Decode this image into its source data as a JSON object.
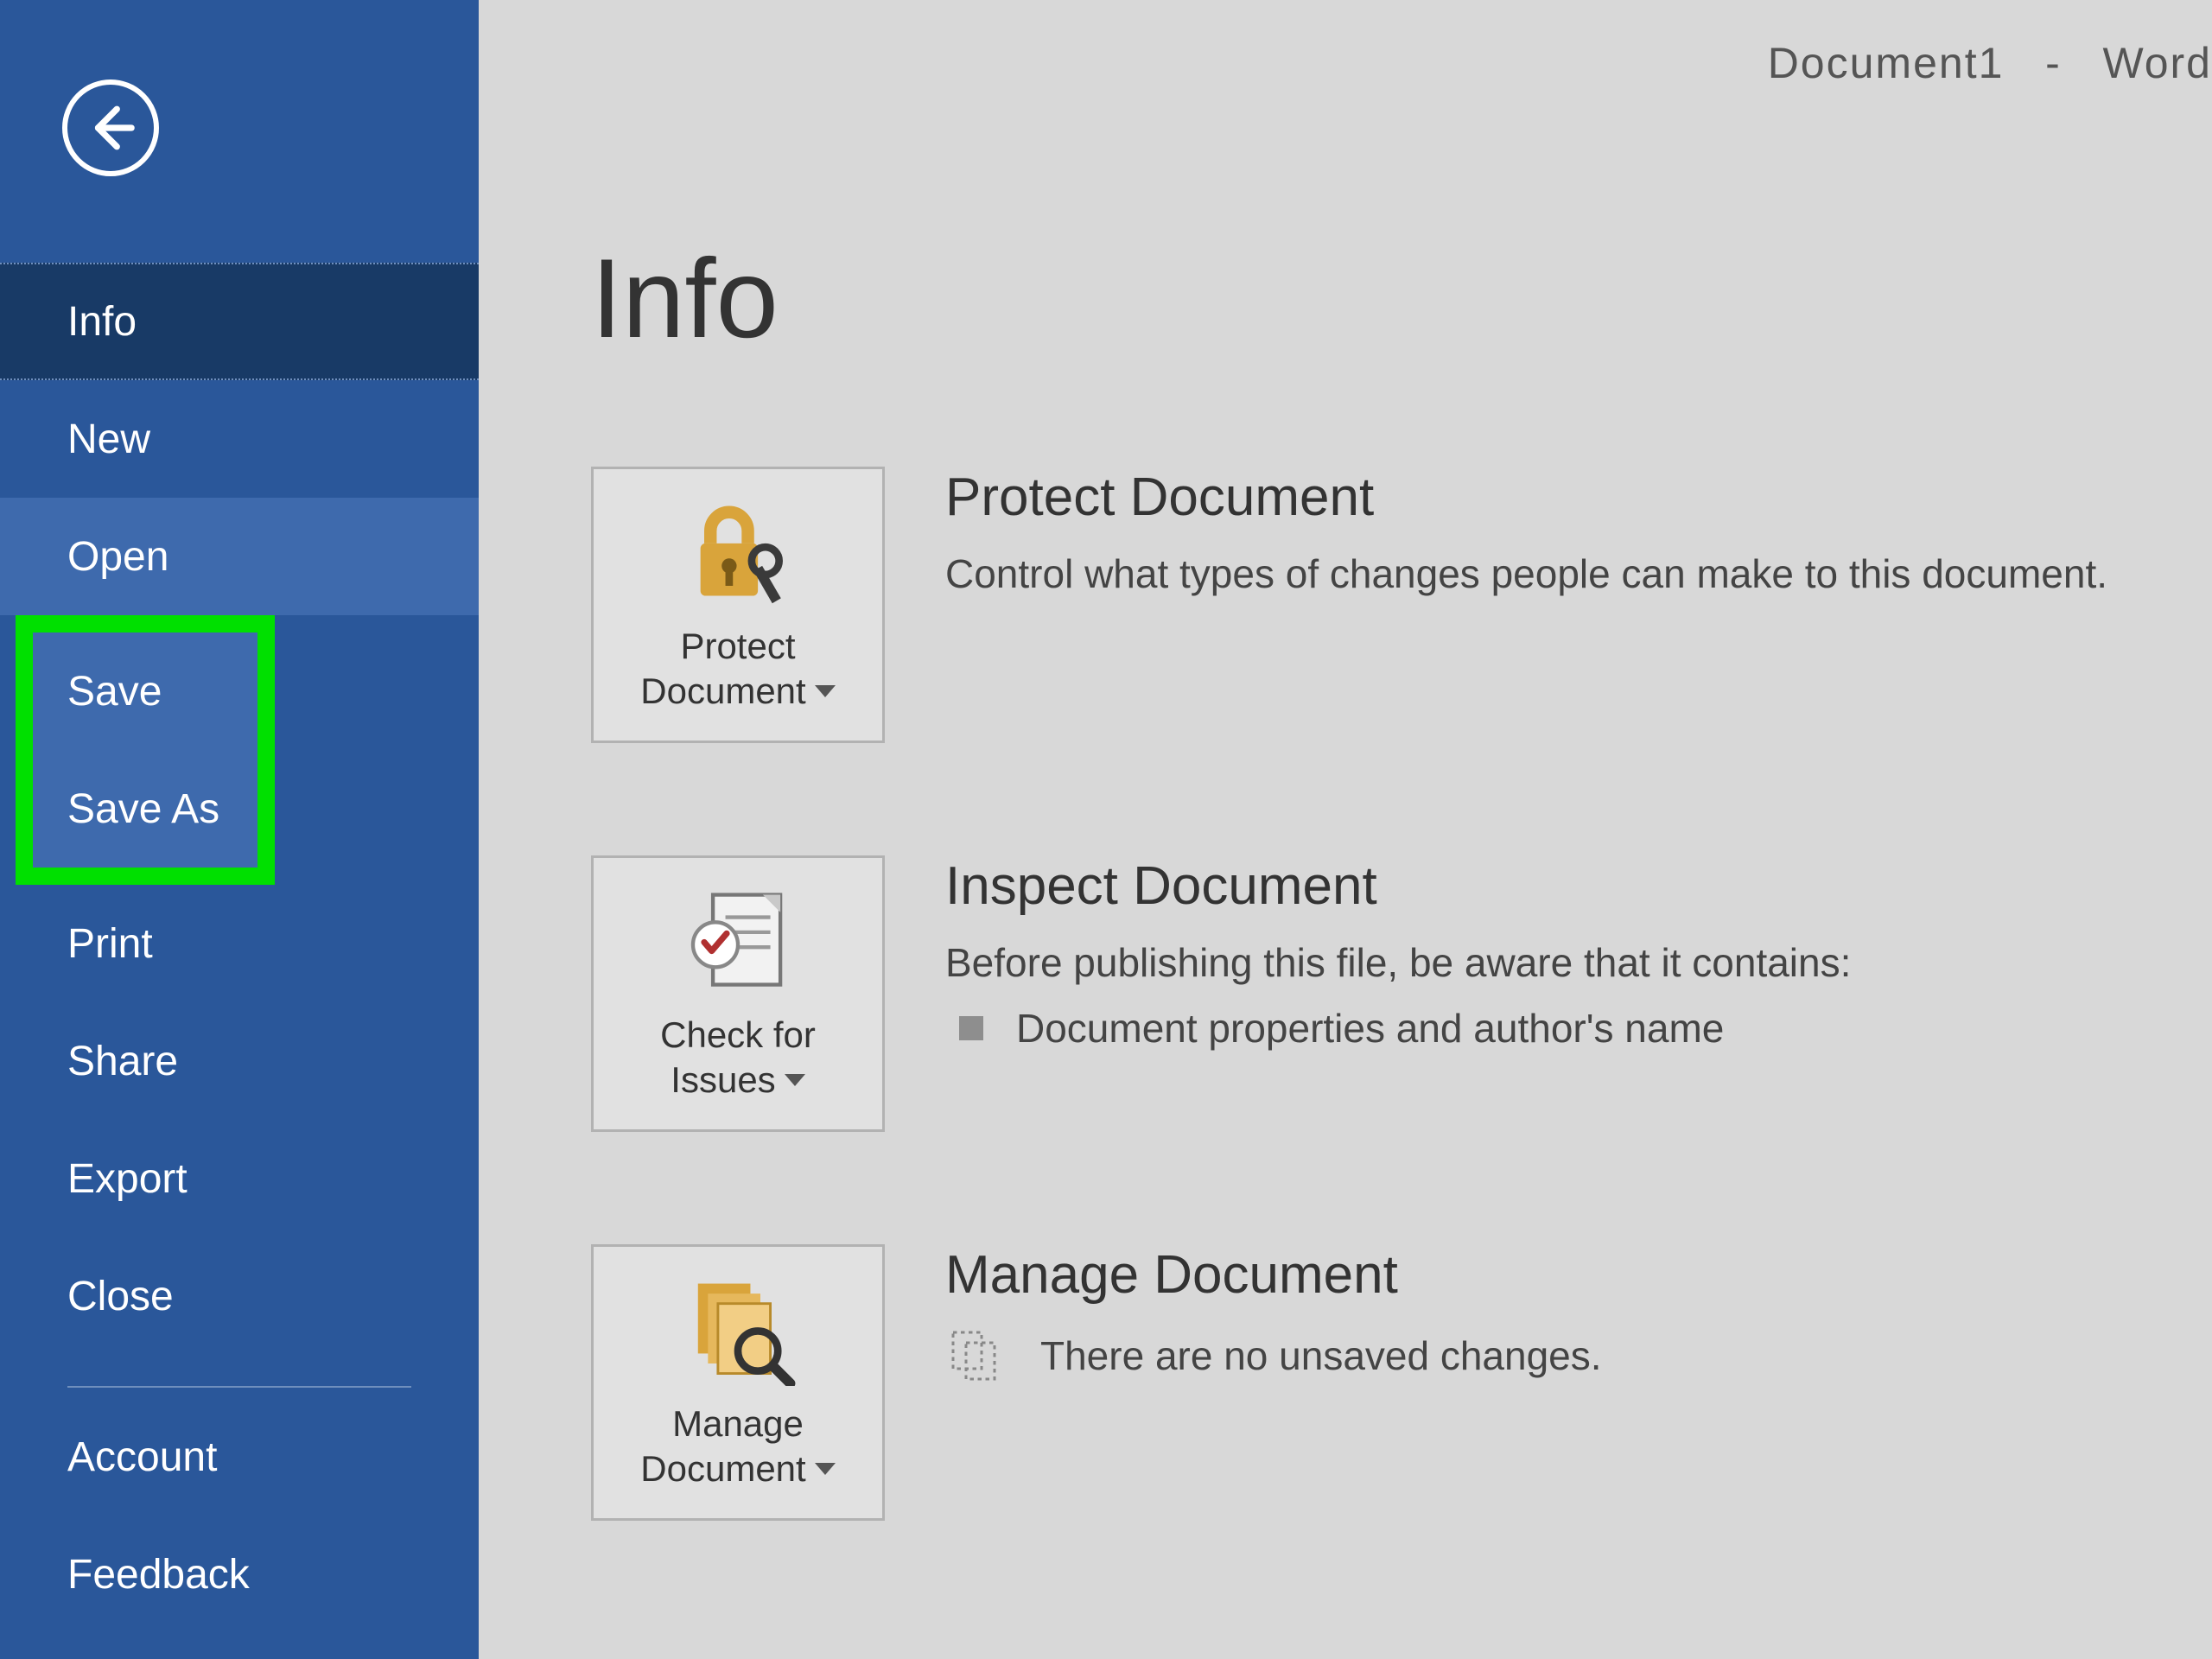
{
  "titlebar": {
    "doc": "Document1",
    "sep": "-",
    "app": "Word"
  },
  "sidebar": {
    "info": "Info",
    "new": "New",
    "open": "Open",
    "save": "Save",
    "save_as": "Save As",
    "print": "Print",
    "share": "Share",
    "export": "Export",
    "close": "Close",
    "account": "Account",
    "feedback": "Feedback"
  },
  "page": {
    "title": "Info"
  },
  "protect": {
    "tile_line1": "Protect",
    "tile_line2": "Document",
    "title": "Protect Document",
    "desc": "Control what types of changes people can make to this document."
  },
  "inspect": {
    "tile_line1": "Check for",
    "tile_line2": "Issues",
    "title": "Inspect Document",
    "desc": "Before publishing this file, be aware that it contains:",
    "bullet1": "Document properties and author's name"
  },
  "manage": {
    "tile_line1": "Manage",
    "tile_line2": "Document",
    "title": "Manage Document",
    "desc": "There are no unsaved changes."
  }
}
